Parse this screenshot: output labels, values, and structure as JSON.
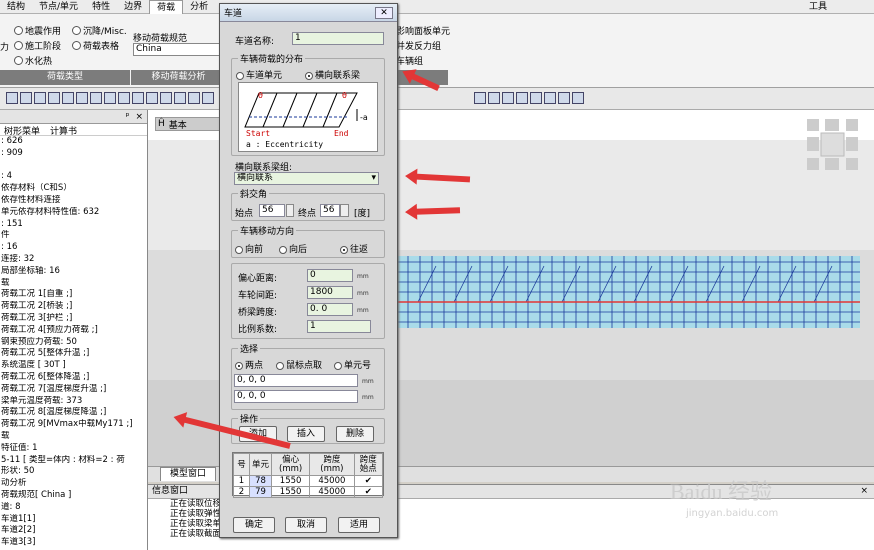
{
  "menu": {
    "items": [
      "结构",
      "节点/单元",
      "特性",
      "边界",
      "荷载",
      "分析",
      "",
      ""
    ],
    "active_index": 4,
    "right_item": "工具"
  },
  "ribbon": {
    "col1": [
      "地震作用",
      "施工阶段",
      "水化热"
    ],
    "col2": [
      "沉降/Misc.",
      "荷载表格"
    ],
    "moving_load_label": "移动荷载规范",
    "moving_load_value": "China",
    "right_items": [
      "影响面板单元",
      "并发反力组",
      "车辆组"
    ],
    "group_load_type": "荷载类型",
    "group_moving_load": "移动荷载分析",
    "prefix_char": "力"
  },
  "tree": {
    "tabs": [
      "树形菜单",
      "计算书"
    ],
    "lines": [
      ": 626",
      ": 909",
      "",
      ": 4",
      "依存材料（C和S）",
      "依存性材料连接",
      "单元依存材料特性值: 632",
      ": 151",
      "件",
      ": 16",
      "连接: 32",
      "局部坐标轴: 16",
      "载",
      "荷载工况 1[自重 ;]",
      "荷载工况 2[桥装 ;]",
      "荷载工况 3[护栏 ;]",
      "荷载工况 4[预应力荷载 ;]",
      "钢束预应力荷载: 50",
      "荷载工况 5[整体升温 ;]",
      "系统温度 [ 30T ]",
      "荷载工况 6[整体降温 ;]",
      "荷载工况 7[温度梯度升温 ;]",
      "梁单元温度荷载: 373",
      "荷载工况 8[温度梯度降温 ;]",
      "荷载工况 9[MVmax中载My171 ;]",
      "载",
      "特征值: 1",
      "5-11 [ 类型=体内 : 材料=2 : 荷",
      "形状: 50",
      "动分析",
      "荷载规范[ China ]",
      "道: 8",
      "车道1[1]",
      "车道2[2]",
      "车道3[3]"
    ]
  },
  "view": {
    "tab_label": "基本",
    "model_window_tab": "模型窗口"
  },
  "info": {
    "title": "信息窗口",
    "lines": [
      "正在读取位移",
      "正在读取弹性",
      "正在读取梁单",
      "正在读取截面温度应力 - 施工阶段分析"
    ]
  },
  "dialog": {
    "title": "车道",
    "lane_name_label": "车道名称:",
    "lane_name_value": "1",
    "dist_title": "车辆荷载的分布",
    "dist_opt1": "车道单元",
    "dist_opt2": "横向联系梁",
    "diagram_start": "Start",
    "diagram_end": "End",
    "diagram_a": "-a",
    "diagram_theta1": "θ",
    "diagram_theta2": "θ",
    "diagram_caption": "a : Eccentricity",
    "cross_group_label": "横向联系梁组:",
    "cross_group_value": "横向联系",
    "skew_title": "斜交角",
    "start_pt_label": "始点",
    "start_pt_value": "56",
    "end_pt_label": "终点",
    "end_pt_value": "56",
    "skew_unit": "[度]",
    "move_title": "车辆移动方向",
    "move_opt1": "向前",
    "move_opt2": "向后",
    "move_opt3": "往返",
    "ecc_label": "偏心距离:",
    "ecc_value": "0",
    "wheel_label": "车轮间距:",
    "wheel_value": "1800",
    "span_label": "桥梁跨度:",
    "span_value": "0. 0",
    "scale_label": "比例系数:",
    "scale_value": "1",
    "unit_mm": "mm",
    "select_title": "选择",
    "sel_opt1": "两点",
    "sel_opt2": "鼠标点取",
    "sel_opt3": "单元号",
    "pt1_value": "0, 0, 0",
    "pt2_value": "0, 0, 0",
    "op_title": "操作",
    "btn_add": "添加",
    "btn_insert": "插入",
    "btn_delete": "删除",
    "table_headers": [
      "号",
      "单元",
      "偏心\n(mm)",
      "跨度\n(mm)",
      "跨度\n始点"
    ],
    "table_rows": [
      [
        "1",
        "78",
        "1550",
        "45000",
        "✔"
      ],
      [
        "2",
        "79",
        "1550",
        "45000",
        "✔"
      ]
    ],
    "btn_ok": "确定",
    "btn_cancel": "取消",
    "btn_apply": "适用"
  },
  "watermark": {
    "main": "Baidu 经验",
    "sub": "jingyan.baidu.com"
  },
  "colors": {
    "accent": "#e23636",
    "structure": "#1a3a9a",
    "mesh_fill": "#a9dbe9"
  }
}
